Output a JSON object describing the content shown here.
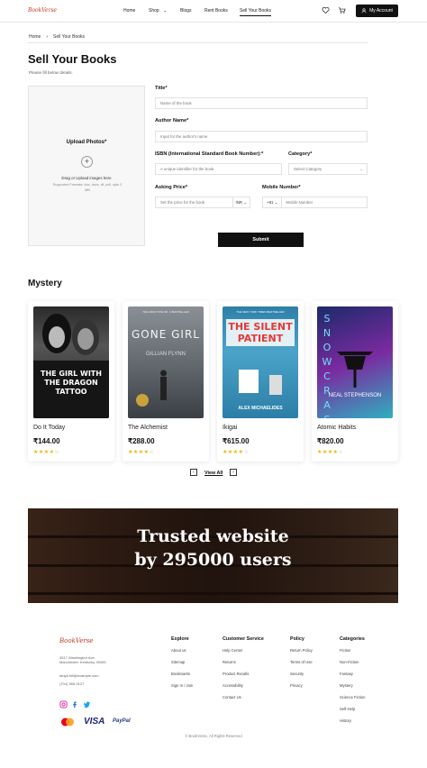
{
  "header": {
    "logo": "BookVerse",
    "nav": [
      {
        "label": "Home",
        "active": false
      },
      {
        "label": "Shop",
        "active": false,
        "has_dropdown": true
      },
      {
        "label": "Blogs",
        "active": false
      },
      {
        "label": "Rent Books",
        "active": false
      },
      {
        "label": "Sell Your Books",
        "active": true
      }
    ],
    "icons": [
      "heart-icon",
      "cart-icon",
      "user-icon"
    ],
    "account_label": "My Account"
  },
  "breadcrumb": {
    "home": "Home",
    "current": "Sell Your Books"
  },
  "page": {
    "title": "Sell Your Books",
    "subtitle": "Please fill below details."
  },
  "upload": {
    "title": "Upload Photos*",
    "hint": "Drag or Upload images here",
    "formats": "Supported Formats: doc, docx, rtf, pdf, upto 2 MB"
  },
  "form": {
    "title": {
      "label": "Title*",
      "placeholder": "Name of the book"
    },
    "author": {
      "label": "Author Name*",
      "placeholder": "Input for the author's name"
    },
    "isbn": {
      "label": "ISBN (International Standard Book Number):*",
      "placeholder": "A unique identifier for the book"
    },
    "category": {
      "label": "Category*",
      "placeholder": "Select Category"
    },
    "price": {
      "label": "Asking Price*",
      "placeholder": "Set the price for the book",
      "currency": "INR"
    },
    "mobile": {
      "label": "Mobile Number*",
      "code": "+91",
      "placeholder": "Mobile Number"
    },
    "submit_label": "Submit"
  },
  "mystery": {
    "title": "Mystery",
    "books": [
      {
        "title": "Do It Today",
        "price": "₹144.00",
        "rating": 4,
        "cover_top": "",
        "cover_main": "THE GIRL WITH THE DRAGON TATTOO"
      },
      {
        "title": "The Alchemist",
        "price": "₹288.00",
        "rating": 4,
        "cover_top": "THE ADDICTIVE NO. 1 BESTSELLER",
        "cover_main": "GONE GIRL",
        "cover_author": "GILLIAN FLYNN"
      },
      {
        "title": "Ikigai",
        "price": "₹615.00",
        "rating": 4,
        "cover_top": "THE NEW YORK TIMES BESTSELLER",
        "cover_main": "THE SILENT PATIENT",
        "cover_author": "ALEX MICHAELIDES"
      },
      {
        "title": "Atomic Habits",
        "price": "₹820.00",
        "rating": 4,
        "cover_main": "SNOW CRASH",
        "cover_author": "NEAL STEPHENSON"
      }
    ],
    "view_all": "View All"
  },
  "banner": {
    "line1": "Trusted website",
    "line2": "by 295000 users"
  },
  "footer": {
    "logo": "BookVerse",
    "address1": "4517 Washington Ave.",
    "address2": "Manchester, Kentucky 39495",
    "email": "tanya.hill@example.com",
    "phone": "(704) 555-0127",
    "columns": [
      {
        "heading": "Explore",
        "links": [
          "About us",
          "Sitemap",
          "Bookmarks",
          "Sign In / Join"
        ]
      },
      {
        "heading": "Customer Service",
        "links": [
          "Help Center",
          "Returns",
          "Product Recalls",
          "Accessibility",
          "Contact Us"
        ]
      },
      {
        "heading": "Policy",
        "links": [
          "Return Policy",
          "Terms of Use",
          "Security",
          "Privacy"
        ]
      },
      {
        "heading": "Categories",
        "links": [
          "Fiction",
          "Non-Fiction",
          "Fantasy",
          "Mystery",
          "Science Fiction",
          "Self-Help",
          "History"
        ]
      }
    ],
    "payments": {
      "visa": "VISA",
      "paypal": "PayPal"
    },
    "copyright": "© BookVerse, All Rights Reserved"
  },
  "colors": {
    "brand": "#c0392b",
    "primary": "#111111",
    "star": "#f0b400"
  }
}
